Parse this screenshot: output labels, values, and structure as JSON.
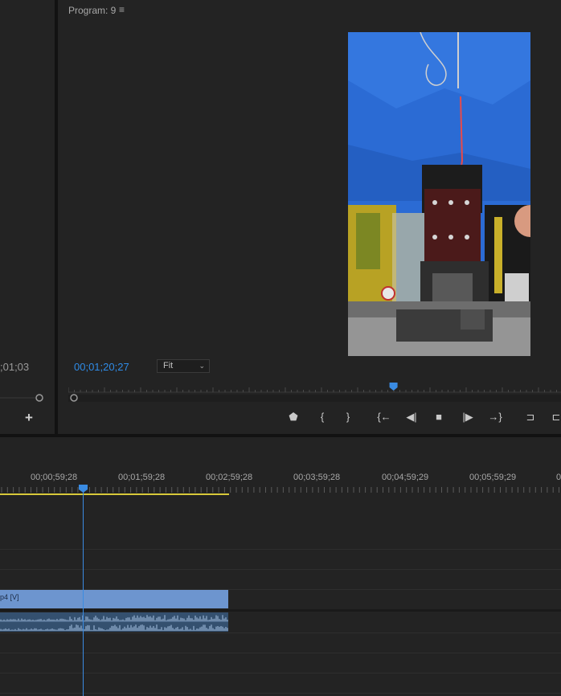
{
  "source_monitor": {
    "timecode": ";01;03"
  },
  "program_monitor": {
    "title": "Program: 9",
    "menu_icon": "hamburger-icon",
    "timecode": "00;01;20;27",
    "zoom": {
      "selected": "Fit"
    },
    "playback_position": 0.66
  },
  "transport_controls": [
    {
      "name": "add-marker-button",
      "icon": "marker-icon",
      "glyph": "⬟"
    },
    {
      "name": "mark-in-button",
      "icon": "mark-in-icon",
      "glyph": "{"
    },
    {
      "name": "mark-out-button",
      "icon": "mark-out-icon",
      "glyph": "}"
    },
    {
      "name": "go-to-in-button",
      "icon": "go-to-in-icon",
      "glyph": "{←"
    },
    {
      "name": "step-back-button",
      "icon": "step-back-icon",
      "glyph": "◀|"
    },
    {
      "name": "stop-button",
      "icon": "stop-icon",
      "glyph": "■"
    },
    {
      "name": "step-forward-button",
      "icon": "step-forward-icon",
      "glyph": "|▶"
    },
    {
      "name": "go-to-out-button",
      "icon": "go-to-out-icon",
      "glyph": "→}"
    },
    {
      "name": "lift-button",
      "icon": "lift-icon",
      "glyph": "⊐"
    },
    {
      "name": "extract-button",
      "icon": "extract-icon",
      "glyph": "⊏"
    }
  ],
  "timeline": {
    "ruler_labels": [
      "00;00;59;28",
      "00;01;59;28",
      "00;02;59;28",
      "00;03;59;28",
      "00;04;59;29",
      "00;05;59;29",
      "0"
    ],
    "video_clip_label": "p4 [V]"
  }
}
